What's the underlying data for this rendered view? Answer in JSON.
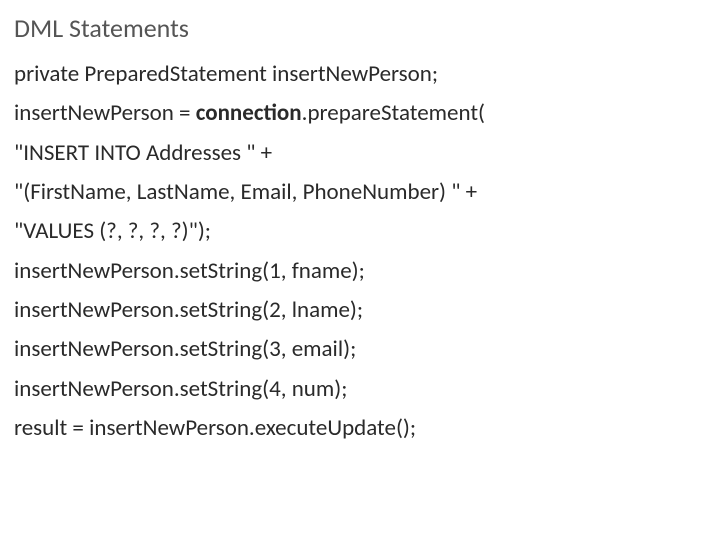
{
  "heading": "DML Statements",
  "lines": {
    "l0": "private PreparedStatement insertNewPerson;",
    "l1a": "insertNewPerson = ",
    "l1b": "connection",
    "l1c": ".prepareStatement(",
    "l2": "\"INSERT INTO Addresses \" +",
    "l3": "\"(FirstName, LastName, Email, PhoneNumber) \" +",
    "l4": "\"VALUES (?, ?, ?, ?)\");",
    "l5": "insertNewPerson.setString(1, fname);",
    "l6": "insertNewPerson.setString(2, lname);",
    "l7": "insertNewPerson.setString(3, email);",
    "l8": "insertNewPerson.setString(4, num);",
    "l9": "result = insertNewPerson.executeUpdate();"
  }
}
